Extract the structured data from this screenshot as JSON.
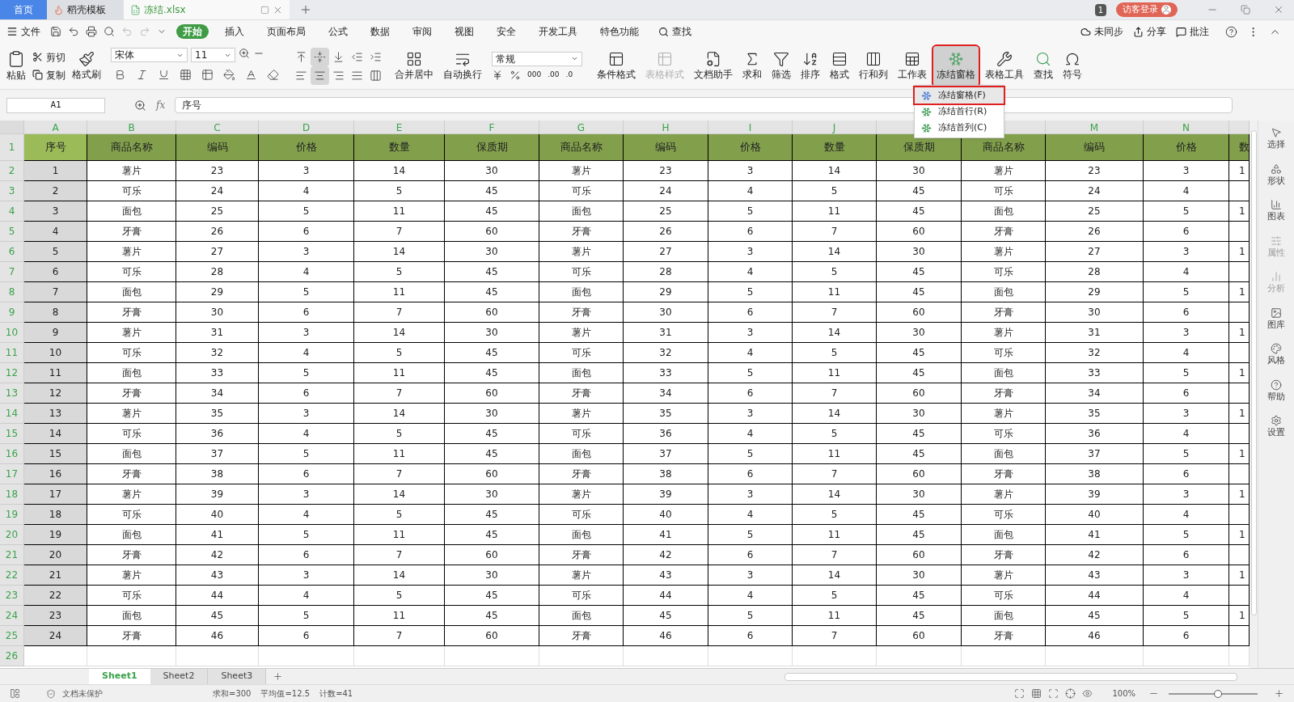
{
  "tabs": [
    {
      "label": "首页",
      "kind": "home",
      "selected": false
    },
    {
      "label": "稻壳模板",
      "kind": "template",
      "selected": false
    },
    {
      "label": "冻结.xlsx",
      "kind": "file",
      "selected": true
    }
  ],
  "title_bar": {
    "badge": "1",
    "login": "访客登录"
  },
  "menu": {
    "file": "文件",
    "items": [
      {
        "label": "开始",
        "selected": true
      },
      {
        "label": "插入",
        "selected": false
      },
      {
        "label": "页面布局",
        "selected": false
      },
      {
        "label": "公式",
        "selected": false
      },
      {
        "label": "数据",
        "selected": false
      },
      {
        "label": "审阅",
        "selected": false
      },
      {
        "label": "视图",
        "selected": false
      },
      {
        "label": "安全",
        "selected": false
      },
      {
        "label": "开发工具",
        "selected": false
      },
      {
        "label": "特色功能",
        "selected": false
      }
    ],
    "search": "查找",
    "right": [
      "未同步",
      "分享",
      "批注"
    ]
  },
  "ribbon": {
    "clipboard": {
      "paste": "粘贴",
      "cut": "剪切",
      "copy": "复制",
      "painter": "格式刷"
    },
    "font": {
      "name": "宋体",
      "size": "11"
    },
    "align": {
      "merge": "合并居中",
      "wrap": "自动换行"
    },
    "number": {
      "format": "常规",
      "thousands": "000",
      "decimals": [
        ".00",
        ".0"
      ]
    },
    "items": [
      {
        "label": "条件格式",
        "kind": "conditional",
        "disabled": false,
        "active": false,
        "annotated": false
      },
      {
        "label": "表格样式",
        "kind": "tablestyle",
        "disabled": true,
        "active": false,
        "annotated": false
      },
      {
        "label": "文档助手",
        "kind": "document",
        "disabled": false,
        "active": false,
        "annotated": false
      },
      {
        "label": "求和",
        "kind": "sum",
        "disabled": false,
        "active": false,
        "annotated": false
      },
      {
        "label": "筛选",
        "kind": "filter",
        "disabled": false,
        "active": false,
        "annotated": false
      },
      {
        "label": "排序",
        "kind": "sort",
        "disabled": false,
        "active": false,
        "annotated": false
      },
      {
        "label": "格式",
        "kind": "format",
        "disabled": false,
        "active": false,
        "annotated": false
      },
      {
        "label": "行和列",
        "kind": "rowcol",
        "disabled": false,
        "active": false,
        "annotated": false
      },
      {
        "label": "工作表",
        "kind": "sheet",
        "disabled": false,
        "active": false,
        "annotated": false
      },
      {
        "label": "冻结窗格",
        "kind": "freeze",
        "disabled": false,
        "active": true,
        "annotated": true
      },
      {
        "label": "表格工具",
        "kind": "tools",
        "disabled": false,
        "active": false,
        "annotated": false
      },
      {
        "label": "查找",
        "kind": "find",
        "disabled": false,
        "active": false,
        "annotated": false
      },
      {
        "label": "符号",
        "kind": "symbol",
        "disabled": false,
        "active": false,
        "annotated": false
      }
    ]
  },
  "freeze_menu": [
    {
      "label": "冻结窗格(F)",
      "selected": true,
      "annotated": true
    },
    {
      "label": "冻结首行(R)",
      "selected": false,
      "annotated": false
    },
    {
      "label": "冻结首列(C)",
      "selected": false,
      "annotated": false
    }
  ],
  "formula_bar": {
    "cell": "A1",
    "fx": "fx",
    "value": "序号"
  },
  "columns": [
    {
      "label": "A",
      "selected": true
    },
    {
      "label": "B",
      "selected": true
    },
    {
      "label": "C",
      "selected": true
    },
    {
      "label": "D",
      "selected": true
    },
    {
      "label": "E",
      "selected": true
    },
    {
      "label": "F",
      "selected": true
    },
    {
      "label": "G",
      "selected": true
    },
    {
      "label": "H",
      "selected": true
    },
    {
      "label": "I",
      "selected": true
    },
    {
      "label": "J",
      "selected": true
    },
    {},
    {},
    {
      "label": "M",
      "selected": true
    },
    {
      "label": "N",
      "selected": true
    }
  ],
  "rows": [
    {
      "number": "1",
      "selected": true,
      "cells": [
        "序号",
        "商品名称",
        "编码",
        "价格",
        "数量",
        "保质期",
        "商品名称",
        "编码",
        "价格",
        "数量",
        "保质期",
        "商品名称",
        "编码",
        "价格",
        "数"
      ]
    },
    {
      "number": "2",
      "selected": true,
      "cells": [
        "1",
        "薯片",
        "23",
        "3",
        "14",
        "30",
        "薯片",
        "23",
        "3",
        "14",
        "30",
        "薯片",
        "23",
        "3",
        "1"
      ]
    },
    {
      "number": "3",
      "selected": true,
      "cells": [
        "2",
        "可乐",
        "24",
        "4",
        "5",
        "45",
        "可乐",
        "24",
        "4",
        "5",
        "45",
        "可乐",
        "24",
        "4"
      ]
    },
    {
      "number": "4",
      "selected": true,
      "cells": [
        "3",
        "面包",
        "25",
        "5",
        "11",
        "45",
        "面包",
        "25",
        "5",
        "11",
        "45",
        "面包",
        "25",
        "5",
        "1"
      ]
    },
    {
      "number": "5",
      "selected": true,
      "cells": [
        "4",
        "牙膏",
        "26",
        "6",
        "7",
        "60",
        "牙膏",
        "26",
        "6",
        "7",
        "60",
        "牙膏",
        "26",
        "6"
      ]
    },
    {
      "number": "6",
      "selected": true,
      "cells": [
        "5",
        "薯片",
        "27",
        "3",
        "14",
        "30",
        "薯片",
        "27",
        "3",
        "14",
        "30",
        "薯片",
        "27",
        "3",
        "1"
      ]
    },
    {
      "number": "7",
      "selected": true,
      "cells": [
        "6",
        "可乐",
        "28",
        "4",
        "5",
        "45",
        "可乐",
        "28",
        "4",
        "5",
        "45",
        "可乐",
        "28",
        "4"
      ]
    },
    {
      "number": "8",
      "selected": true,
      "cells": [
        "7",
        "面包",
        "29",
        "5",
        "11",
        "45",
        "面包",
        "29",
        "5",
        "11",
        "45",
        "面包",
        "29",
        "5",
        "1"
      ]
    },
    {
      "number": "9",
      "selected": true,
      "cells": [
        "8",
        "牙膏",
        "30",
        "6",
        "7",
        "60",
        "牙膏",
        "30",
        "6",
        "7",
        "60",
        "牙膏",
        "30",
        "6"
      ]
    },
    {
      "number": "10",
      "selected": true,
      "cells": [
        "9",
        "薯片",
        "31",
        "3",
        "14",
        "30",
        "薯片",
        "31",
        "3",
        "14",
        "30",
        "薯片",
        "31",
        "3",
        "1"
      ]
    },
    {
      "number": "11",
      "selected": true,
      "cells": [
        "10",
        "可乐",
        "32",
        "4",
        "5",
        "45",
        "可乐",
        "32",
        "4",
        "5",
        "45",
        "可乐",
        "32",
        "4"
      ]
    },
    {
      "number": "12",
      "selected": true,
      "cells": [
        "11",
        "面包",
        "33",
        "5",
        "11",
        "45",
        "面包",
        "33",
        "5",
        "11",
        "45",
        "面包",
        "33",
        "5",
        "1"
      ]
    },
    {
      "number": "13",
      "selected": true,
      "cells": [
        "12",
        "牙膏",
        "34",
        "6",
        "7",
        "60",
        "牙膏",
        "34",
        "6",
        "7",
        "60",
        "牙膏",
        "34",
        "6"
      ]
    },
    {
      "number": "14",
      "selected": true,
      "cells": [
        "13",
        "薯片",
        "35",
        "3",
        "14",
        "30",
        "薯片",
        "35",
        "3",
        "14",
        "30",
        "薯片",
        "35",
        "3",
        "1"
      ]
    },
    {
      "number": "15",
      "selected": true,
      "cells": [
        "14",
        "可乐",
        "36",
        "4",
        "5",
        "45",
        "可乐",
        "36",
        "4",
        "5",
        "45",
        "可乐",
        "36",
        "4"
      ]
    },
    {
      "number": "16",
      "selected": true,
      "cells": [
        "15",
        "面包",
        "37",
        "5",
        "11",
        "45",
        "面包",
        "37",
        "5",
        "11",
        "45",
        "面包",
        "37",
        "5",
        "1"
      ]
    },
    {
      "number": "17",
      "selected": true,
      "cells": [
        "16",
        "牙膏",
        "38",
        "6",
        "7",
        "60",
        "牙膏",
        "38",
        "6",
        "7",
        "60",
        "牙膏",
        "38",
        "6"
      ]
    },
    {
      "number": "18",
      "selected": true,
      "cells": [
        "17",
        "薯片",
        "39",
        "3",
        "14",
        "30",
        "薯片",
        "39",
        "3",
        "14",
        "30",
        "薯片",
        "39",
        "3",
        "1"
      ]
    },
    {
      "number": "19",
      "selected": true,
      "cells": [
        "18",
        "可乐",
        "40",
        "4",
        "5",
        "45",
        "可乐",
        "40",
        "4",
        "5",
        "45",
        "可乐",
        "40",
        "4"
      ]
    },
    {
      "number": "20",
      "selected": true,
      "cells": [
        "19",
        "面包",
        "41",
        "5",
        "11",
        "45",
        "面包",
        "41",
        "5",
        "11",
        "45",
        "面包",
        "41",
        "5",
        "1"
      ]
    },
    {
      "number": "21",
      "selected": true,
      "cells": [
        "20",
        "牙膏",
        "42",
        "6",
        "7",
        "60",
        "牙膏",
        "42",
        "6",
        "7",
        "60",
        "牙膏",
        "42",
        "6"
      ]
    },
    {
      "number": "22",
      "selected": true,
      "cells": [
        "21",
        "薯片",
        "43",
        "3",
        "14",
        "30",
        "薯片",
        "43",
        "3",
        "14",
        "30",
        "薯片",
        "43",
        "3",
        "1"
      ]
    },
    {
      "number": "23",
      "selected": true,
      "cells": [
        "22",
        "可乐",
        "44",
        "4",
        "5",
        "45",
        "可乐",
        "44",
        "4",
        "5",
        "45",
        "可乐",
        "44",
        "4"
      ]
    },
    {
      "number": "24",
      "selected": true,
      "cells": [
        "23",
        "面包",
        "45",
        "5",
        "11",
        "45",
        "面包",
        "45",
        "5",
        "11",
        "45",
        "面包",
        "45",
        "5",
        "1"
      ]
    },
    {
      "number": "25",
      "selected": true,
      "cells": [
        "24",
        "牙膏",
        "46",
        "6",
        "7",
        "60",
        "牙膏",
        "46",
        "6",
        "7",
        "60",
        "牙膏",
        "46",
        "6"
      ]
    },
    {
      "number": "26",
      "selected": true
    }
  ],
  "sidebar": [
    {
      "label": "选择",
      "kind": "select",
      "disabled": false
    },
    {
      "label": "形状",
      "kind": "shape",
      "disabled": false
    },
    {
      "label": "图表",
      "kind": "chart",
      "disabled": false
    },
    {
      "label": "属性",
      "kind": "props",
      "disabled": true
    },
    {
      "label": "分析",
      "kind": "analyze",
      "disabled": true
    },
    {
      "label": "图库",
      "kind": "gallery",
      "disabled": false
    },
    {
      "label": "风格",
      "kind": "style",
      "disabled": false
    },
    {
      "label": "帮助",
      "kind": "help",
      "disabled": false
    },
    {
      "label": "设置",
      "kind": "settings",
      "disabled": false
    }
  ],
  "sheets": [
    {
      "label": "Sheet1",
      "selected": true
    },
    {
      "label": "Sheet2",
      "selected": false
    },
    {
      "label": "Sheet3",
      "selected": false
    }
  ],
  "status": {
    "protect": "文档未保护",
    "stats": [
      "求和=300",
      "平均值=12.5",
      "计数=41"
    ],
    "zoom": "100%",
    "zoom_slider": {
      "level": 0.55
    }
  }
}
